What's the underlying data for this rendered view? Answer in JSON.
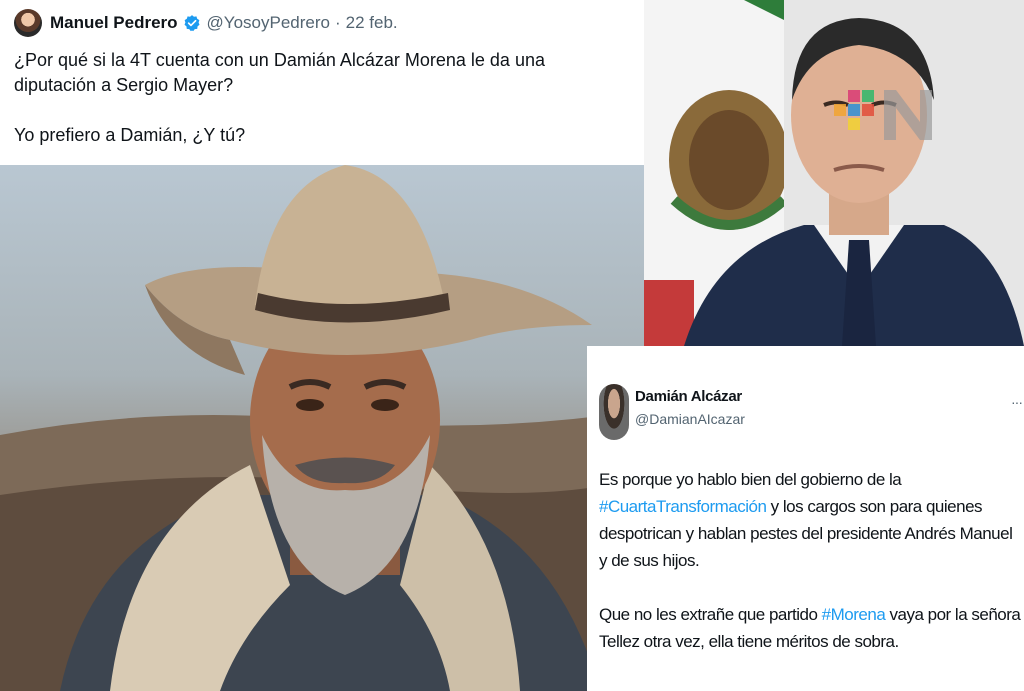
{
  "tweet_top": {
    "author_name": "Manuel Pedrero",
    "handle": "@YosoyPedrero",
    "separator": "·",
    "date": "22 feb.",
    "paragraph_1": "¿Por qué si la 4T cuenta con un Damián Alcázar Morena le da una diputación a Sergio Mayer?",
    "paragraph_2": "Yo prefiero a Damián, ¿Y tú?",
    "icons": {
      "verified": "verified-badge-icon",
      "avatar": "avatar"
    }
  },
  "tweet_bottom": {
    "author_name": "Damián Alcázar",
    "handle": "@DamianAIcazar",
    "more": "···",
    "p1_before": "Es porque yo hablo bien del gobierno de la ",
    "p1_hashtag": "#CuartaTransformación",
    "p1_after": " y los cargos son para quienes despotrican y hablan pestes del presidente Andrés Manuel y de sus hijos.",
    "p2_before": "Que no les extrañe que partido ",
    "p2_hashtag": "#Morena",
    "p2_after": " vaya por la señora Tellez otra vez, ella tiene méritos de sobra."
  },
  "colors": {
    "hashtag": "#1d9bf0",
    "verified": "#1d9bf0",
    "text": "#0f1419",
    "secondary": "#536471"
  },
  "images": {
    "cowboy_photo": "photo of a bearded man in a wide-brimmed hat",
    "politician_photo": "photo of a man in a suit in front of the Mexican flag"
  }
}
